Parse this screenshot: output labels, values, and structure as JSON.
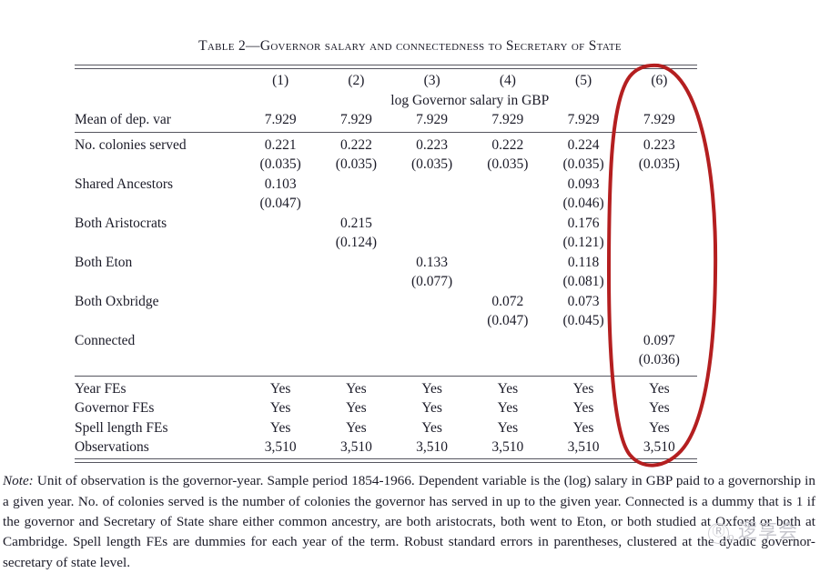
{
  "title": {
    "prefix": "Table 2—",
    "text": "Governor salary and connectedness to Secretary of State",
    "full": "Table 2—Governor salary and connectedness to Secretary of State"
  },
  "table": {
    "column_numbers": [
      "(1)",
      "(2)",
      "(3)",
      "(4)",
      "(5)",
      "(6)"
    ],
    "span_header": "log Governor salary in GBP",
    "mean_row": {
      "label": "Mean of dep. var",
      "values": [
        "7.929",
        "7.929",
        "7.929",
        "7.929",
        "7.929",
        "7.929"
      ]
    },
    "coefficient_rows": [
      {
        "label": "No. colonies served",
        "estimates": [
          "0.221",
          "0.222",
          "0.223",
          "0.222",
          "0.224",
          "0.223"
        ],
        "std_errors": [
          "(0.035)",
          "(0.035)",
          "(0.035)",
          "(0.035)",
          "(0.035)",
          "(0.035)"
        ]
      },
      {
        "label": "Shared Ancestors",
        "estimates": [
          "0.103",
          "",
          "",
          "",
          "0.093",
          ""
        ],
        "std_errors": [
          "(0.047)",
          "",
          "",
          "",
          "(0.046)",
          ""
        ]
      },
      {
        "label": "Both Aristocrats",
        "estimates": [
          "",
          "0.215",
          "",
          "",
          "0.176",
          ""
        ],
        "std_errors": [
          "",
          "(0.124)",
          "",
          "",
          "(0.121)",
          ""
        ]
      },
      {
        "label": "Both Eton",
        "estimates": [
          "",
          "",
          "0.133",
          "",
          "0.118",
          ""
        ],
        "std_errors": [
          "",
          "",
          "(0.077)",
          "",
          "(0.081)",
          ""
        ]
      },
      {
        "label": "Both Oxbridge",
        "estimates": [
          "",
          "",
          "",
          "0.072",
          "0.073",
          ""
        ],
        "std_errors": [
          "",
          "",
          "",
          "(0.047)",
          "(0.045)",
          ""
        ]
      },
      {
        "label": "Connected",
        "estimates": [
          "",
          "",
          "",
          "",
          "",
          "0.097"
        ],
        "std_errors": [
          "",
          "",
          "",
          "",
          "",
          "(0.036)"
        ]
      }
    ],
    "footer_rows": [
      {
        "label": "Year FEs",
        "values": [
          "Yes",
          "Yes",
          "Yes",
          "Yes",
          "Yes",
          "Yes"
        ]
      },
      {
        "label": "Governor FEs",
        "values": [
          "Yes",
          "Yes",
          "Yes",
          "Yes",
          "Yes",
          "Yes"
        ]
      },
      {
        "label": "Spell length FEs",
        "values": [
          "Yes",
          "Yes",
          "Yes",
          "Yes",
          "Yes",
          "Yes"
        ]
      },
      {
        "label": "Observations",
        "values": [
          "3,510",
          "3,510",
          "3,510",
          "3,510",
          "3,510",
          "3,510"
        ]
      }
    ]
  },
  "note": {
    "label": "Note:",
    "body": " Unit of observation is the governor-year. Sample period 1854-1966. Dependent variable is the (log) salary in GBP paid to a governorship in a given year. No. of colonies served is the number of colonies the governor has served in up to the given year. Connected is a dummy that is 1 if the governor and Secretary of State share either common ancestry, are both aristocrats, both went to Eton, or both studied at Oxford or both at Cambridge. Spell length FEs are dummies for each year of the term. Robust standard errors in parentheses, clustered at the dyadic governor-secretary of state level."
  },
  "annotation": {
    "kind": "ellipse-highlight",
    "target_column": "(6)",
    "color": "#b41f20",
    "stroke_width": 4
  },
  "watermark": {
    "mark": "Ⓡ",
    "suffix": "o",
    "cjk_text": "逻享会",
    "color": "#c6c6cd"
  }
}
